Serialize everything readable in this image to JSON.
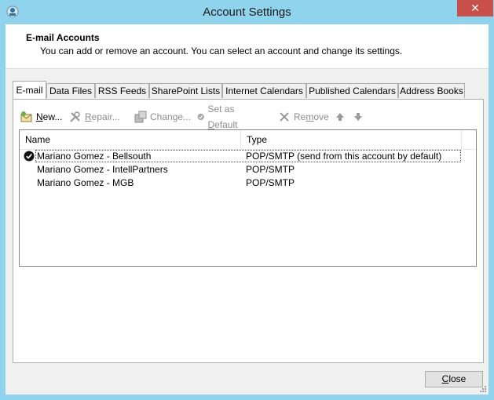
{
  "window": {
    "title": "Account Settings",
    "close_glyph": "✕"
  },
  "header": {
    "title": "E-mail Accounts",
    "subtitle": "You can add or remove an account. You can select an account and change its settings."
  },
  "tabs": [
    {
      "label": "E-mail",
      "active": true
    },
    {
      "label": "Data Files"
    },
    {
      "label": "RSS Feeds"
    },
    {
      "label": "SharePoint Lists"
    },
    {
      "label": "Internet Calendars"
    },
    {
      "label": "Published Calendars"
    },
    {
      "label": "Address Books"
    }
  ],
  "toolbar": {
    "new": {
      "pre": "",
      "ul": "N",
      "post": "ew...",
      "icon": "new-account-icon"
    },
    "repair": {
      "pre": "",
      "ul": "R",
      "post": "epair...",
      "icon": "repair-tools-icon"
    },
    "change": {
      "pre": "Change",
      "ul": "",
      "post": "...",
      "icon": "change-icon"
    },
    "set_default": {
      "pre": "Set as ",
      "ul": "D",
      "post": "efault",
      "icon": "check-circle-icon"
    },
    "remove": {
      "pre": "Re",
      "ul": "m",
      "post": "ove",
      "icon": "remove-x-icon"
    },
    "up_icon": "arrow-up-icon",
    "down_icon": "arrow-down-icon"
  },
  "accounts": {
    "columns": [
      "Name",
      "Type"
    ],
    "rows": [
      {
        "name": "Mariano Gomez - Bellsouth",
        "type": "POP/SMTP (send from this account by default)",
        "default": true
      },
      {
        "name": "Mariano Gomez - IntellPartners",
        "type": "POP/SMTP"
      },
      {
        "name": "Mariano Gomez - MGB",
        "type": "POP/SMTP"
      }
    ]
  },
  "footer": {
    "close": {
      "ul": "C",
      "post": "lose"
    }
  },
  "colors": {
    "titlebar": "#8fd3ec",
    "close_button": "#c7504b",
    "dialog_bg": "#f0f0f0"
  }
}
